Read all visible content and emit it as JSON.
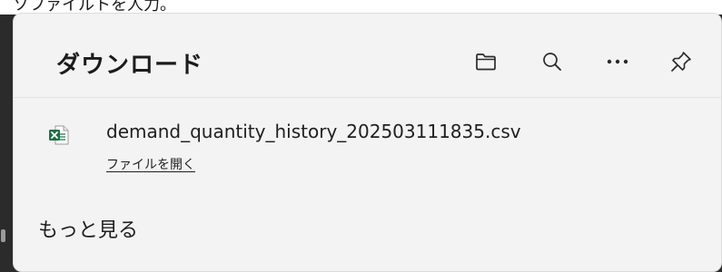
{
  "window": {
    "top_text": "ソファイルトを人力。"
  },
  "panel": {
    "title": "ダウンロード",
    "actions": {
      "folder_icon": "folder-icon",
      "search_icon": "search-icon",
      "more_icon": "more-horizontal-icon",
      "pin_icon": "pin-icon"
    }
  },
  "downloads": [
    {
      "filename": "demand_quantity_history_202503111835.csv",
      "action_label": "ファイルを開く",
      "file_icon": "excel-csv-icon",
      "icon_color": "#1d7044"
    }
  ],
  "footer": {
    "more_label": "もっと見る"
  }
}
